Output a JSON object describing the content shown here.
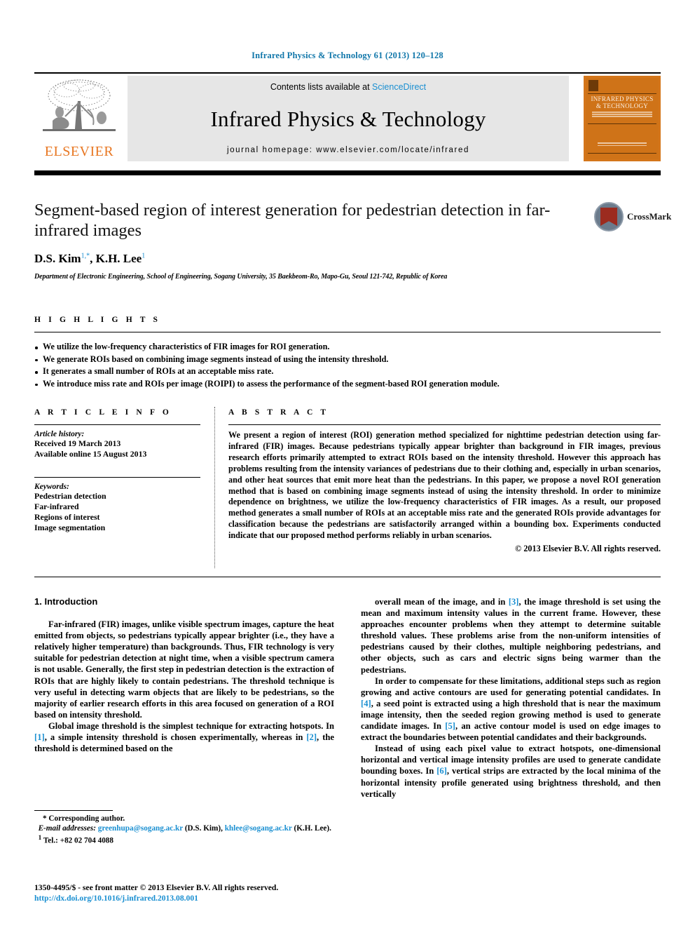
{
  "running_head": "Infrared Physics & Technology 61 (2013) 120–128",
  "masthead": {
    "contents_prefix": "Contents lists available at ",
    "sciencedirect": "ScienceDirect",
    "journal_title": "Infrared Physics & Technology",
    "homepage": "journal homepage: www.elsevier.com/locate/infrared",
    "publisher_wordmark": "ELSEVIER",
    "cover_title_line1": "INFRARED PHYSICS",
    "cover_title_line2": "& TECHNOLOGY",
    "accent_orange": "#E87722",
    "link_blue": "#1a8fd1"
  },
  "crossmark": {
    "label": "CrossMark"
  },
  "article": {
    "title": "Segment-based region of interest generation for pedestrian detection in far-infrared images",
    "authors_plain": "D.S. Kim 1,*, K.H. Lee 1",
    "author1_name": "D.S. Kim",
    "author1_sup": "1,*",
    "author2_name": "K.H. Lee",
    "author2_sup": "1",
    "affiliation": "Department of Electronic Engineering, School of Engineering, Sogang University, 35 Baekbeom-Ro, Mapo-Gu, Seoul 121-742, Republic of Korea"
  },
  "highlights": {
    "heading": "H I G H L I G H T S",
    "items": [
      "We utilize the low-frequency characteristics of FIR images for ROI generation.",
      "We generate ROIs based on combining image segments instead of using the intensity threshold.",
      "It generates a small number of ROIs at an acceptable miss rate.",
      "We introduce miss rate and ROIs per image (ROIPI) to assess the performance of the segment-based ROI generation module."
    ]
  },
  "article_info": {
    "heading": "A R T I C L E   I N F O",
    "history_label": "Article history:",
    "history_lines": [
      "Received 19 March 2013",
      "Available online 15 August 2013"
    ],
    "keywords_label": "Keywords:",
    "keywords": [
      "Pedestrian detection",
      "Far-infrared",
      "Regions of interest",
      "Image segmentation"
    ]
  },
  "abstract": {
    "heading": "A B S T R A C T",
    "text": "We present a region of interest (ROI) generation method specialized for nighttime pedestrian detection using far-infrared (FIR) images. Because pedestrians typically appear brighter than background in FIR images, previous research efforts primarily attempted to extract ROIs based on the intensity threshold. However this approach has problems resulting from the intensity variances of pedestrians due to their clothing and, especially in urban scenarios, and other heat sources that emit more heat than the pedestrians. In this paper, we propose a novel ROI generation method that is based on combining image segments instead of using the intensity threshold. In order to minimize dependence on brightness, we utilize the low-frequency characteristics of FIR images. As a result, our proposed method generates a small number of ROIs at an acceptable miss rate and the generated ROIs provide advantages for classification because the pedestrians are satisfactorily arranged within a bounding box. Experiments conducted indicate that our proposed method performs reliably in urban scenarios.",
    "copyright": "© 2013 Elsevier B.V. All rights reserved."
  },
  "body": {
    "section_title": "1. Introduction",
    "left_para1": "Far-infrared (FIR) images, unlike visible spectrum images, capture the heat emitted from objects, so pedestrians typically appear brighter (i.e., they have a relatively higher temperature) than backgrounds. Thus, FIR technology is very suitable for pedestrian detection at night time, when a visible spectrum camera is not usable. Generally, the first step in pedestrian detection is the extraction of ROIs that are highly likely to contain pedestrians. The threshold technique is very useful in detecting warm objects that are likely to be pedestrians, so the majority of earlier research efforts in this area focused on generation of a ROI based on intensity threshold.",
    "left_para2_a": "Global image threshold is the simplest technique for extracting hotspots. In ",
    "left_ref1": "[1]",
    "left_para2_b": ", a simple intensity threshold is chosen experimentally, whereas in ",
    "left_ref2": "[2]",
    "left_para2_c": ", the threshold is determined based on the",
    "right_para1_a": "overall mean of the image, and in ",
    "right_ref3": "[3]",
    "right_para1_b": ", the image threshold is set using the mean and maximum intensity values in the current frame. However, these approaches encounter problems when they attempt to determine suitable threshold values. These problems arise from the non-uniform intensities of pedestrians caused by their clothes, multiple neighboring pedestrians, and other objects, such as cars and electric signs being warmer than the pedestrians.",
    "right_para2_a": "In order to compensate for these limitations, additional steps such as region growing and active contours are used for generating potential candidates. In ",
    "right_ref4": "[4]",
    "right_para2_b": ", a seed point is extracted using a high threshold that is near the maximum image intensity, then the seeded region growing method is used to generate candidate images. In ",
    "right_ref5": "[5]",
    "right_para2_c": ", an active contour model is used on edge images to extract the boundaries between potential candidates and their backgrounds.",
    "right_para3_a": "Instead of using each pixel value to extract hotspots, one-dimensional horizontal and vertical image intensity profiles are used to generate candidate bounding boxes. In ",
    "right_ref6": "[6]",
    "right_para3_b": ", vertical strips are extracted by the local minima of the horizontal intensity profile generated using brightness threshold, and then vertically"
  },
  "footnote": {
    "corresponding": "* Corresponding author.",
    "email_label": "E-mail addresses:",
    "email1": "greenhupa@sogang.ac.kr",
    "email1_owner": "(D.S. Kim),",
    "email2": "khlee@sogang.ac.kr",
    "email2_owner": "(K.H. Lee).",
    "tel_sup": "1",
    "tel": "Tel.: +82 02 704 4088"
  },
  "imprint": {
    "issn_line": "1350-4495/$ - see front matter © 2013 Elsevier B.V. All rights reserved.",
    "doi": "http://dx.doi.org/10.1016/j.infrared.2013.08.001"
  }
}
